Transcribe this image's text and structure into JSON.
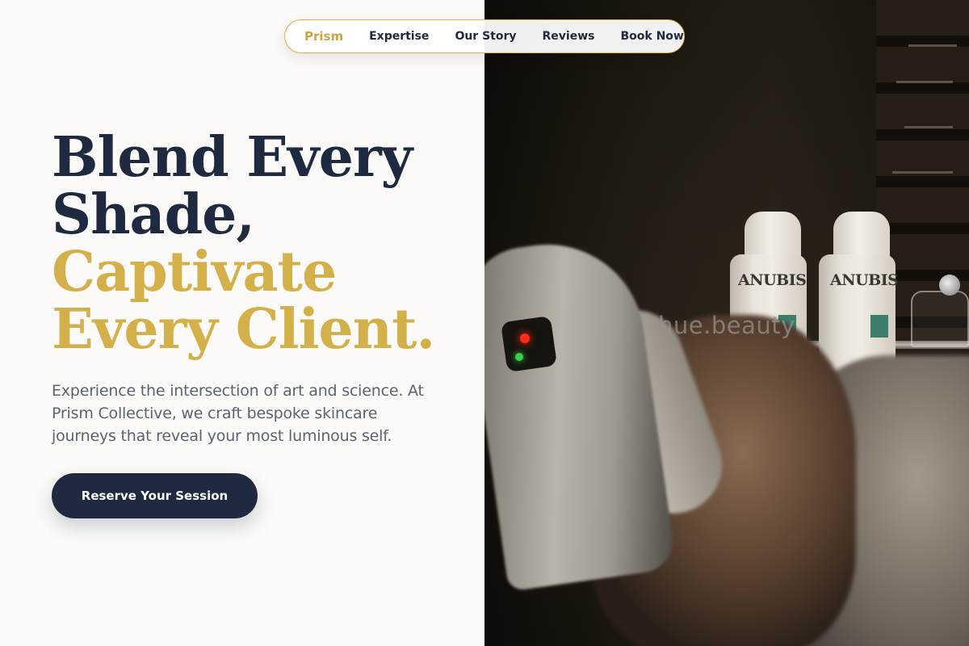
{
  "nav": {
    "brand": "Prism",
    "items": [
      {
        "label": "Expertise"
      },
      {
        "label": "Our Story"
      },
      {
        "label": "Reviews"
      },
      {
        "label": "Book Now"
      }
    ]
  },
  "hero": {
    "headline_line1": "Blend Every",
    "headline_line2": "Shade,",
    "headline_line3": "Captivate",
    "headline_line4": "Every Client.",
    "lead": "Experience the intersection of art and science. At Prism Collective, we craft bespoke skincare journeys that reveal your most luminous self.",
    "cta_label": "Reserve Your Session"
  },
  "photo": {
    "product_label_1": "ANUBIS",
    "product_label_2": "ANUBIS",
    "watermark": "hue.beauty"
  },
  "colors": {
    "navy": "#1f2a40",
    "gold": "#d4b04a",
    "background": "#fcfbf9",
    "body_text": "#5c6272"
  }
}
